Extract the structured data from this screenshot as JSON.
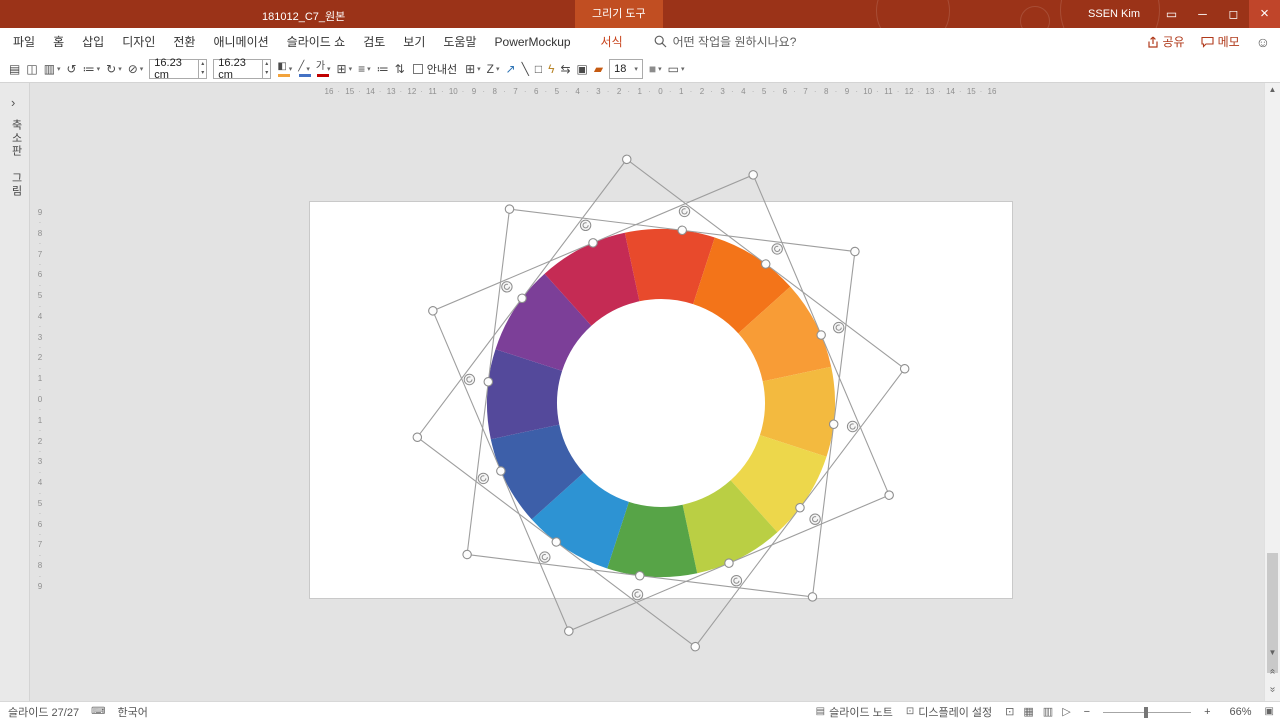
{
  "titlebar": {
    "title": "181012_C7_원본",
    "contextual_tab": "그리기 도구",
    "user": "SSEN Kim",
    "controls": {
      "ribbon_options": "▭",
      "minimize": "─",
      "maximize": "◻",
      "close": "×"
    }
  },
  "menubar": {
    "items": [
      "파일",
      "홈",
      "삽입",
      "디자인",
      "전환",
      "애니메이션",
      "슬라이드 쇼",
      "검토",
      "보기",
      "도움말",
      "PowerMockup"
    ],
    "format_tab": "서식",
    "search_placeholder": "어떤 작업을 원하시나요?",
    "share": "공유",
    "memo": "메모",
    "smiley": "☺"
  },
  "toolbar": {
    "caret_glyph": "▾",
    "spin_up_glyph": "▴",
    "spin_down_glyph": "▾",
    "items": [
      {
        "type": "icon",
        "name": "paste",
        "glyph": "▤"
      },
      {
        "type": "icon",
        "name": "new-slide",
        "glyph": "◫"
      },
      {
        "type": "icon",
        "name": "layout",
        "glyph": "▥",
        "caret": true
      },
      {
        "type": "icon",
        "name": "reset",
        "glyph": "↺"
      },
      {
        "type": "icon",
        "name": "section",
        "glyph": "≔",
        "caret": true
      },
      {
        "type": "icon",
        "name": "rotate",
        "glyph": "↻",
        "caret": true
      },
      {
        "type": "icon",
        "name": "shape-ellipse",
        "glyph": "⊘",
        "caret": true
      },
      {
        "type": "spinner",
        "name": "shape-height",
        "value": "16.23 cm"
      },
      {
        "type": "spinner",
        "name": "shape-width",
        "value": "16.23 cm"
      },
      {
        "type": "icon",
        "name": "shape-fill",
        "glyph": "◧",
        "caret": true,
        "underline": "#F2A33C"
      },
      {
        "type": "icon",
        "name": "shape-outline",
        "glyph": "╱",
        "caret": true,
        "underline": "#4472C4"
      },
      {
        "type": "icon",
        "name": "font-color",
        "glyph": "가",
        "caret": true,
        "underline": "#C00000"
      },
      {
        "type": "icon",
        "name": "draw-table",
        "glyph": "⊞",
        "caret": true
      },
      {
        "type": "icon",
        "name": "align",
        "glyph": "≡",
        "caret": true
      },
      {
        "type": "icon",
        "name": "bullets",
        "glyph": "≔"
      },
      {
        "type": "icon",
        "name": "sort",
        "glyph": "⇅"
      },
      {
        "type": "checkbox",
        "name": "guides",
        "label": "안내선",
        "checked": false
      },
      {
        "type": "icon",
        "name": "grid",
        "glyph": "⊞",
        "caret": true
      },
      {
        "type": "icon",
        "name": "ink-pen",
        "glyph": "Z",
        "caret": true
      },
      {
        "type": "icon",
        "name": "connector",
        "glyph": "↗",
        "color": "#2E74B5"
      },
      {
        "type": "icon",
        "name": "eyedropper",
        "glyph": "╲"
      },
      {
        "type": "icon",
        "name": "rectangle",
        "glyph": "□"
      },
      {
        "type": "icon",
        "name": "lightning",
        "glyph": "ϟ",
        "color": "#B8862B"
      },
      {
        "type": "icon",
        "name": "distribute",
        "glyph": "⇆"
      },
      {
        "type": "icon",
        "name": "picture",
        "glyph": "▣"
      },
      {
        "type": "icon",
        "name": "brush",
        "glyph": "▰",
        "color": "#C55A11"
      },
      {
        "type": "combo",
        "name": "font-size",
        "value": "18"
      },
      {
        "type": "icon",
        "name": "shape-style",
        "glyph": "■",
        "caret": true,
        "color": "#8C8C8C"
      },
      {
        "type": "icon",
        "name": "char-border",
        "glyph": "▭",
        "caret": true
      }
    ]
  },
  "panel": {
    "chevron": "›",
    "label": "축소판 그림"
  },
  "rulers": {
    "dot": "·",
    "horizontal_numbers": [
      "16",
      "15",
      "14",
      "13",
      "12",
      "11",
      "10",
      "9",
      "8",
      "7",
      "6",
      "5",
      "4",
      "3",
      "2",
      "1",
      "0",
      "1",
      "2",
      "3",
      "4",
      "5",
      "6",
      "7",
      "8",
      "9",
      "10",
      "11",
      "12",
      "13",
      "14",
      "15",
      "16"
    ],
    "vertical_numbers": [
      "9",
      "8",
      "7",
      "6",
      "5",
      "4",
      "3",
      "2",
      "1",
      "0",
      "1",
      "2",
      "3",
      "4",
      "5",
      "6",
      "7",
      "8",
      "9"
    ]
  },
  "wheel": {
    "segments": [
      "#E84A2C",
      "#F37419",
      "#F89C36",
      "#F3BA3F",
      "#EDD74B",
      "#BACF44",
      "#57A447",
      "#2D93D3",
      "#3D5FA9",
      "#54499B",
      "#7C3F98",
      "#C52B54"
    ],
    "outer_radius": 174,
    "inner_radius": 104,
    "start_angle": -12
  },
  "selection": {
    "square_rotations": [
      7,
      37,
      67
    ],
    "half_size": 174,
    "rotation_handle_radius": 193,
    "rotation_handle_angles": [
      7,
      37,
      67,
      97,
      127,
      157,
      187,
      217,
      247,
      277,
      307,
      337
    ]
  },
  "scrollbar": {
    "up": "▲",
    "down": "▼",
    "prev": "«",
    "next": "»"
  },
  "statusbar": {
    "slide_label": "슬라이드 27/27",
    "proofing_glyph": "⌨",
    "language": "한국어",
    "notes_glyph": "▤",
    "notes_label": "슬라이드 노트",
    "display_glyph": "⊡",
    "display_label": "디스플레이 설정",
    "views": [
      {
        "name": "normal-view",
        "glyph": "⊡"
      },
      {
        "name": "slide-sorter-view",
        "glyph": "▦"
      },
      {
        "name": "reading-view",
        "glyph": "▥"
      },
      {
        "name": "slideshow-view",
        "glyph": "▷"
      }
    ],
    "zoom_out": "−",
    "zoom_in": "+",
    "zoom": "66%",
    "fit": "▣"
  }
}
